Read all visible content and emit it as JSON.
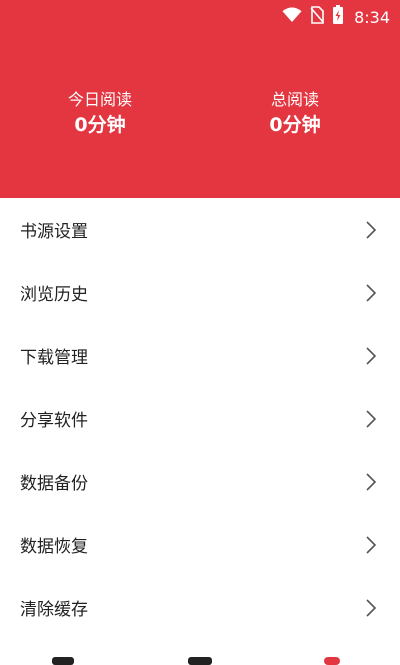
{
  "status_bar": {
    "time": "8:34",
    "icons": [
      "wifi-icon",
      "no-sim-icon",
      "battery-charging-icon"
    ]
  },
  "header": {
    "background_color": "#e33641",
    "today_reading": {
      "label": "今日阅读",
      "value": "0分钟"
    },
    "total_reading": {
      "label": "总阅读",
      "value": "0分钟"
    }
  },
  "menu": {
    "items": [
      {
        "label": "书源设置",
        "icon": "chevron-right-icon"
      },
      {
        "label": "浏览历史",
        "icon": "chevron-right-icon"
      },
      {
        "label": "下载管理",
        "icon": "chevron-right-icon"
      },
      {
        "label": "分享软件",
        "icon": "chevron-right-icon"
      },
      {
        "label": "数据备份",
        "icon": "chevron-right-icon"
      },
      {
        "label": "数据恢复",
        "icon": "chevron-right-icon"
      },
      {
        "label": "清除缓存",
        "icon": "chevron-right-icon"
      }
    ]
  }
}
